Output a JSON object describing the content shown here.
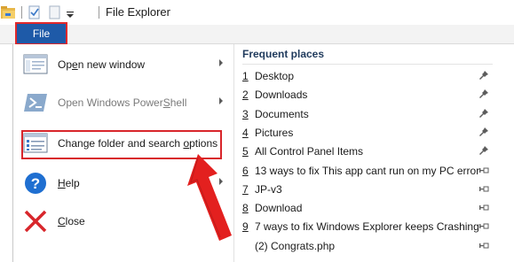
{
  "window": {
    "title": "File Explorer"
  },
  "ribbon": {
    "file_tab_label": "File"
  },
  "menu": {
    "items": [
      {
        "label_pre": "Op",
        "label_u": "e",
        "label_post": "n new window",
        "has_submenu": true,
        "enabled": true,
        "icon": "new-window-icon"
      },
      {
        "label_pre": "Open Windows Power",
        "label_u": "S",
        "label_post": "hell",
        "has_submenu": true,
        "enabled": false,
        "icon": "powershell-icon"
      },
      {
        "label_pre": "Change folder and search ",
        "label_u": "o",
        "label_post": "ptions",
        "has_submenu": false,
        "enabled": true,
        "icon": "folder-options-icon"
      },
      {
        "label_pre": "",
        "label_u": "H",
        "label_post": "elp",
        "has_submenu": true,
        "enabled": true,
        "icon": "help-icon"
      },
      {
        "label_pre": "",
        "label_u": "C",
        "label_post": "lose",
        "has_submenu": false,
        "enabled": true,
        "icon": "close-icon"
      }
    ]
  },
  "frequent": {
    "header": "Frequent places",
    "items": [
      {
        "num": "1",
        "name": "Desktop",
        "pin": "pinned-icon"
      },
      {
        "num": "2",
        "name": "Downloads",
        "pin": "pinned-icon"
      },
      {
        "num": "3",
        "name": "Documents",
        "pin": "pinned-icon"
      },
      {
        "num": "4",
        "name": "Pictures",
        "pin": "pinned-icon"
      },
      {
        "num": "5",
        "name": "All Control Panel Items",
        "pin": "pinned-icon"
      },
      {
        "num": "6",
        "name": "13 ways to fix This app cant run on my PC error",
        "pin": "unpinned-icon"
      },
      {
        "num": "7",
        "name": "JP-v3",
        "pin": "unpinned-icon"
      },
      {
        "num": "8",
        "name": "Download",
        "pin": "unpinned-icon"
      },
      {
        "num": "9",
        "name": "7 ways to fix Windows Explorer keeps Crashing",
        "pin": "unpinned-icon"
      },
      {
        "num": "",
        "name": "(2) Congrats.php",
        "pin": "unpinned-icon"
      }
    ]
  },
  "colors": {
    "file_tab": "#1e5aa8",
    "highlight": "#e0282b",
    "header_text": "#1f3a5c"
  }
}
